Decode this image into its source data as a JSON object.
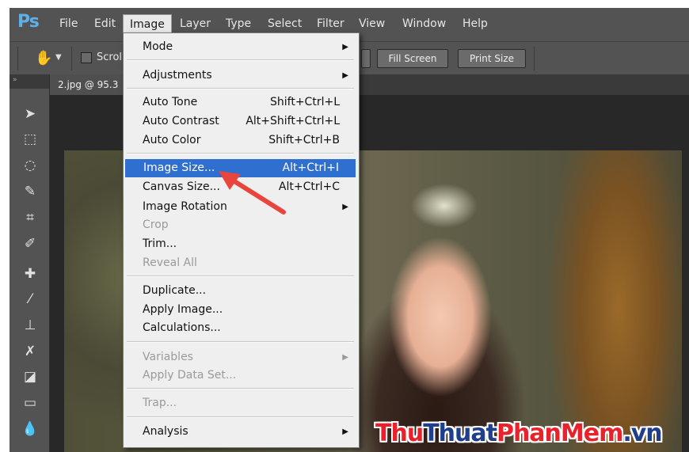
{
  "app": {
    "logo": "Ps"
  },
  "menubar": {
    "items": [
      "File",
      "Edit",
      "Image",
      "Layer",
      "Type",
      "Select",
      "Filter",
      "View",
      "Window",
      "Help"
    ],
    "active": "Image"
  },
  "options_bar": {
    "scroll_label": "Scroll",
    "fill_screen": "Fill Screen",
    "print_size": "Print Size"
  },
  "document": {
    "tab_title": "2.jpg @ 95.3"
  },
  "image_menu": {
    "items": [
      {
        "label": "Mode",
        "shortcut": "",
        "submenu": true,
        "disabled": false
      },
      {
        "label": "Adjustments",
        "shortcut": "",
        "submenu": true,
        "disabled": false
      },
      {
        "label": "Auto Tone",
        "shortcut": "Shift+Ctrl+L",
        "submenu": false,
        "disabled": false
      },
      {
        "label": "Auto Contrast",
        "shortcut": "Alt+Shift+Ctrl+L",
        "submenu": false,
        "disabled": false
      },
      {
        "label": "Auto Color",
        "shortcut": "Shift+Ctrl+B",
        "submenu": false,
        "disabled": false
      },
      {
        "label": "Image Size...",
        "shortcut": "Alt+Ctrl+I",
        "submenu": false,
        "disabled": false,
        "highlighted": true
      },
      {
        "label": "Canvas Size...",
        "shortcut": "Alt+Ctrl+C",
        "submenu": false,
        "disabled": false
      },
      {
        "label": "Image Rotation",
        "shortcut": "",
        "submenu": true,
        "disabled": false
      },
      {
        "label": "Crop",
        "shortcut": "",
        "submenu": false,
        "disabled": true
      },
      {
        "label": "Trim...",
        "shortcut": "",
        "submenu": false,
        "disabled": false
      },
      {
        "label": "Reveal All",
        "shortcut": "",
        "submenu": false,
        "disabled": true
      },
      {
        "label": "Duplicate...",
        "shortcut": "",
        "submenu": false,
        "disabled": false
      },
      {
        "label": "Apply Image...",
        "shortcut": "",
        "submenu": false,
        "disabled": false
      },
      {
        "label": "Calculations...",
        "shortcut": "",
        "submenu": false,
        "disabled": false
      },
      {
        "label": "Variables",
        "shortcut": "",
        "submenu": true,
        "disabled": true
      },
      {
        "label": "Apply Data Set...",
        "shortcut": "",
        "submenu": false,
        "disabled": true
      },
      {
        "label": "Trap...",
        "shortcut": "",
        "submenu": false,
        "disabled": true
      },
      {
        "label": "Analysis",
        "shortcut": "",
        "submenu": true,
        "disabled": false
      }
    ]
  },
  "tools": [
    "move-tool-icon",
    "marquee-tool-icon",
    "lasso-tool-icon",
    "quick-selection-tool-icon",
    "crop-tool-icon",
    "eyedropper-tool-icon",
    "healing-brush-tool-icon",
    "brush-tool-icon",
    "clone-stamp-tool-icon",
    "history-brush-tool-icon",
    "eraser-tool-icon",
    "gradient-tool-icon",
    "blur-tool-icon"
  ],
  "watermark": {
    "part1": "Thu",
    "part2": "Thuat",
    "part3": "PhanMem",
    "part4": ".vn"
  },
  "colors": {
    "highlight": "#2f6fd0",
    "arrow": "#e8453c",
    "watermark": "#e8212b",
    "logo": "#5fb0e8"
  }
}
